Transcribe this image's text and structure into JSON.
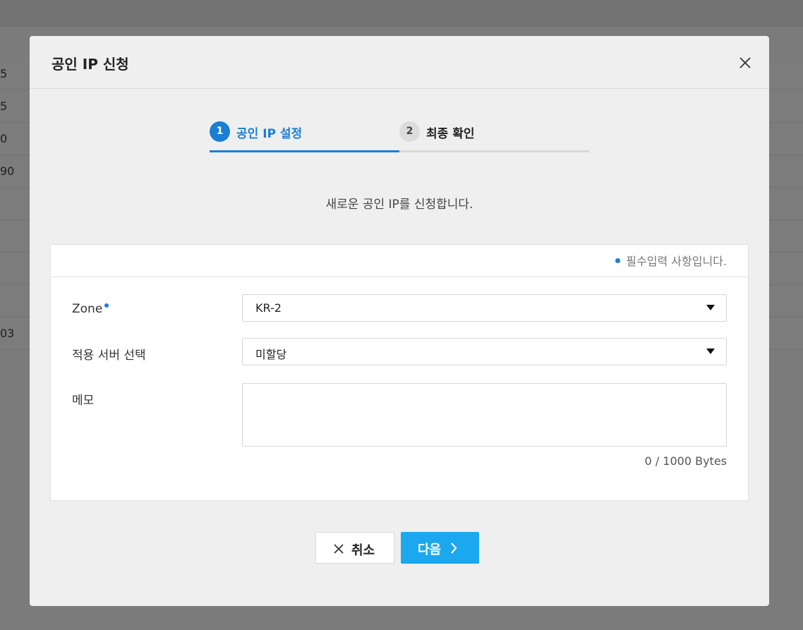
{
  "background": {
    "rows": [
      "5",
      "5",
      "0",
      "90",
      "",
      "",
      "",
      "",
      "03"
    ]
  },
  "modal": {
    "title": "공인 IP 신청",
    "steps": [
      {
        "num": "1",
        "label": "공인 IP 설정"
      },
      {
        "num": "2",
        "label": "최종 확인"
      }
    ],
    "intro": "새로운 공인 IP를 신청합니다.",
    "required_note": "필수입력 사항입니다.",
    "form": {
      "zone_label": "Zone",
      "zone_value": "KR-2",
      "server_label": "적용 서버 선택",
      "server_value": "미할당",
      "memo_label": "메모",
      "memo_value": "",
      "byte_count": "0 / 1000 Bytes"
    },
    "buttons": {
      "cancel": "취소",
      "next": "다음"
    }
  },
  "colors": {
    "accent": "#1a7fd4",
    "primary_button": "#1ba8ef"
  }
}
